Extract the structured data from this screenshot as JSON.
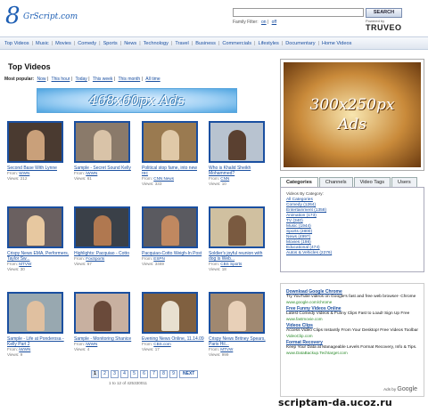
{
  "logo": {
    "mark": "8",
    "text": "GrScript.com"
  },
  "search": {
    "button_label": "SEARCH",
    "value": ""
  },
  "family_filter": {
    "label": "Family Filter:",
    "on": "on",
    "off": "off"
  },
  "powered": {
    "label": "Powered by",
    "brand": "TRUVEO"
  },
  "nav": [
    "Top Videos",
    "Music",
    "Movies",
    "Comedy",
    "Sports",
    "News",
    "Technology",
    "Travel",
    "Business",
    "Commercials",
    "Lifestyles",
    "Documentary",
    "Home Videos"
  ],
  "page_title": "Top Videos",
  "most_popular": {
    "label": "Most popular:",
    "links": [
      "Now",
      "This hour",
      "Today",
      "This week",
      "This month",
      "All time"
    ]
  },
  "ad_banner": "468x60px Ads",
  "videos": [
    {
      "title": "Second Base With Lynne",
      "from": "WWN",
      "views": "Views: 212",
      "bg": "#4a3a30",
      "fig": "#c9a07a"
    },
    {
      "title": "Sample - Secret Sound Kelly",
      "from": "iWWN",
      "views": "Views: 61",
      "bg": "#8a7a6a",
      "fig": "#d9c3a8"
    },
    {
      "title": "Political stop fame, into new rec",
      "from": "CNN News",
      "views": "Views: 333",
      "bg": "#9a7a50",
      "fig": "#e0c9a8"
    },
    {
      "title": "Who is Khalid Sheikh Mohammed?",
      "from": "CNN",
      "views": "Views: 10",
      "bg": "#b8c3d0",
      "fig": "#5a4030"
    },
    {
      "title": "Crispy News EMA, Performers, Taylor Sw...",
      "from": "MTVW",
      "views": "Views: 30",
      "bg": "#6a6060",
      "fig": "#e7c8a0"
    },
    {
      "title": "Highlights: Pacquiao - Cotto",
      "from": "FoxSports",
      "views": "Views: 67",
      "bg": "#3a4048",
      "fig": "#b07850"
    },
    {
      "title": "Pacquiao-Cotto Weigh-In Post",
      "from": "ESPN",
      "views": "Views: 3469",
      "bg": "#5a5a60",
      "fig": "#c08860"
    },
    {
      "title": "Soldier's joyful reunion with dog is Web...",
      "from": "CBS Sports",
      "views": "Views: 18",
      "bg": "#d0c0a0",
      "fig": "#7a5a40"
    },
    {
      "title": "Sample - Life at Ponderosa - Kelly Part 2",
      "from": "iWWN",
      "views": "Views: 9",
      "bg": "#98a8b0",
      "fig": "#e0c0a0"
    },
    {
      "title": "Sample - Monitoring Shanice",
      "from": "iWWN",
      "views": "Views: 4",
      "bg": "#c8b0a0",
      "fig": "#6a4a3a"
    },
    {
      "title": "Evening News Online, 11.14.09",
      "from": "CBS.com",
      "views": "Views: 17",
      "bg": "#806040",
      "fig": "#e8e0d0"
    },
    {
      "title": "Crispy News Britney Spears, Paris Hil...",
      "from": "MTVW",
      "views": "Views: 999",
      "bg": "#a08870",
      "fig": "#e8d0b8"
    }
  ],
  "pagination": {
    "pages": [
      "1",
      "2",
      "3",
      "4",
      "5",
      "6",
      "7",
      "8",
      "9"
    ],
    "current": "1",
    "next": "NEXT"
  },
  "results": "1 to 12 of 425330011",
  "ad_box": {
    "line1": "300x250px",
    "line2": "Ads"
  },
  "tabs": [
    "Categories",
    "Channels",
    "Video Tags",
    "Users"
  ],
  "categories": {
    "heading": "Videos By Category:",
    "items": [
      "All Categories",
      "Comedy (1264)",
      "Entertainment (1358)",
      "Animation (173)",
      "TV (340)",
      "Music (1944)",
      "Sports (2800)",
      "News (4997)",
      "Movies (198)",
      "Educational (474)",
      "Autos & Vehicles (2276)"
    ]
  },
  "google_ads": [
    {
      "title": "Download Google Chrome",
      "desc": "Try YouTube videos on Google's fast and free web browser- Chrome",
      "url": "www.google.com/chrome"
    },
    {
      "title": "Free Funny Videos Online",
      "desc": "Latest Comedy Videos & Funny Clips Fast to Load! Sign Up Free",
      "url": "www.fastmovie.com"
    },
    {
      "title": "Videos Clips",
      "desc": "Access Video Clips Instantly From Your Desktop! Free Videos Toolbar",
      "url": "VideoClip.com"
    },
    {
      "title": "Format Recovery",
      "desc": "Keep Your Data at Manageable Levels Format Recovery, Info & Tips.",
      "url": "www.DataBackup.Techtarget.com"
    }
  ],
  "ads_by": {
    "label": "Ads by",
    "brand": "Google"
  },
  "watermark": "scriptam-da.ucoz.ru"
}
